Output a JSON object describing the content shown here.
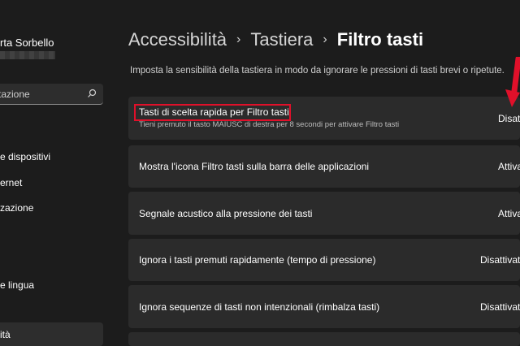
{
  "sidebar": {
    "user_name": "rta Sorbello",
    "search_placeholder": "tazione",
    "items": [
      {
        "label": "e dispositivi"
      },
      {
        "label": "ernet"
      },
      {
        "label": "zazione"
      },
      {
        "label": "e lingua"
      },
      {
        "label": "ità"
      }
    ]
  },
  "breadcrumb": {
    "part1": "Accessibilità",
    "part2": "Tastiera",
    "current": "Filtro tasti",
    "separator": "›"
  },
  "description": "Imposta la sensibilità della tastiera in modo da ignorare le pressioni di tasti brevi o ripetute.",
  "settings": [
    {
      "title": "Tasti di scelta rapida per Filtro tasti",
      "subtitle": "Tieni premuto il tasto MAIUSC di destra per 8 secondi per attivare Filtro tasti",
      "status": "Disatt"
    },
    {
      "title": "Mostra l'icona Filtro tasti sulla barra delle applicazioni",
      "status": "Attiva"
    },
    {
      "title": "Segnale acustico alla pressione dei tasti",
      "status": "Attiva"
    },
    {
      "title": "Ignora i tasti premuti rapidamente (tempo di pressione)",
      "status": "Disattivato"
    },
    {
      "title": "Ignora sequenze di tasti non intenzionali (rimbalza tasti)",
      "status": "Disattivato"
    }
  ],
  "colors": {
    "background": "#1c1c1c",
    "card": "#2b2b2b",
    "highlight": "#e0102a"
  },
  "icons": [
    "search-icon",
    "chevron-right-icon",
    "red-arrow-annotation"
  ]
}
